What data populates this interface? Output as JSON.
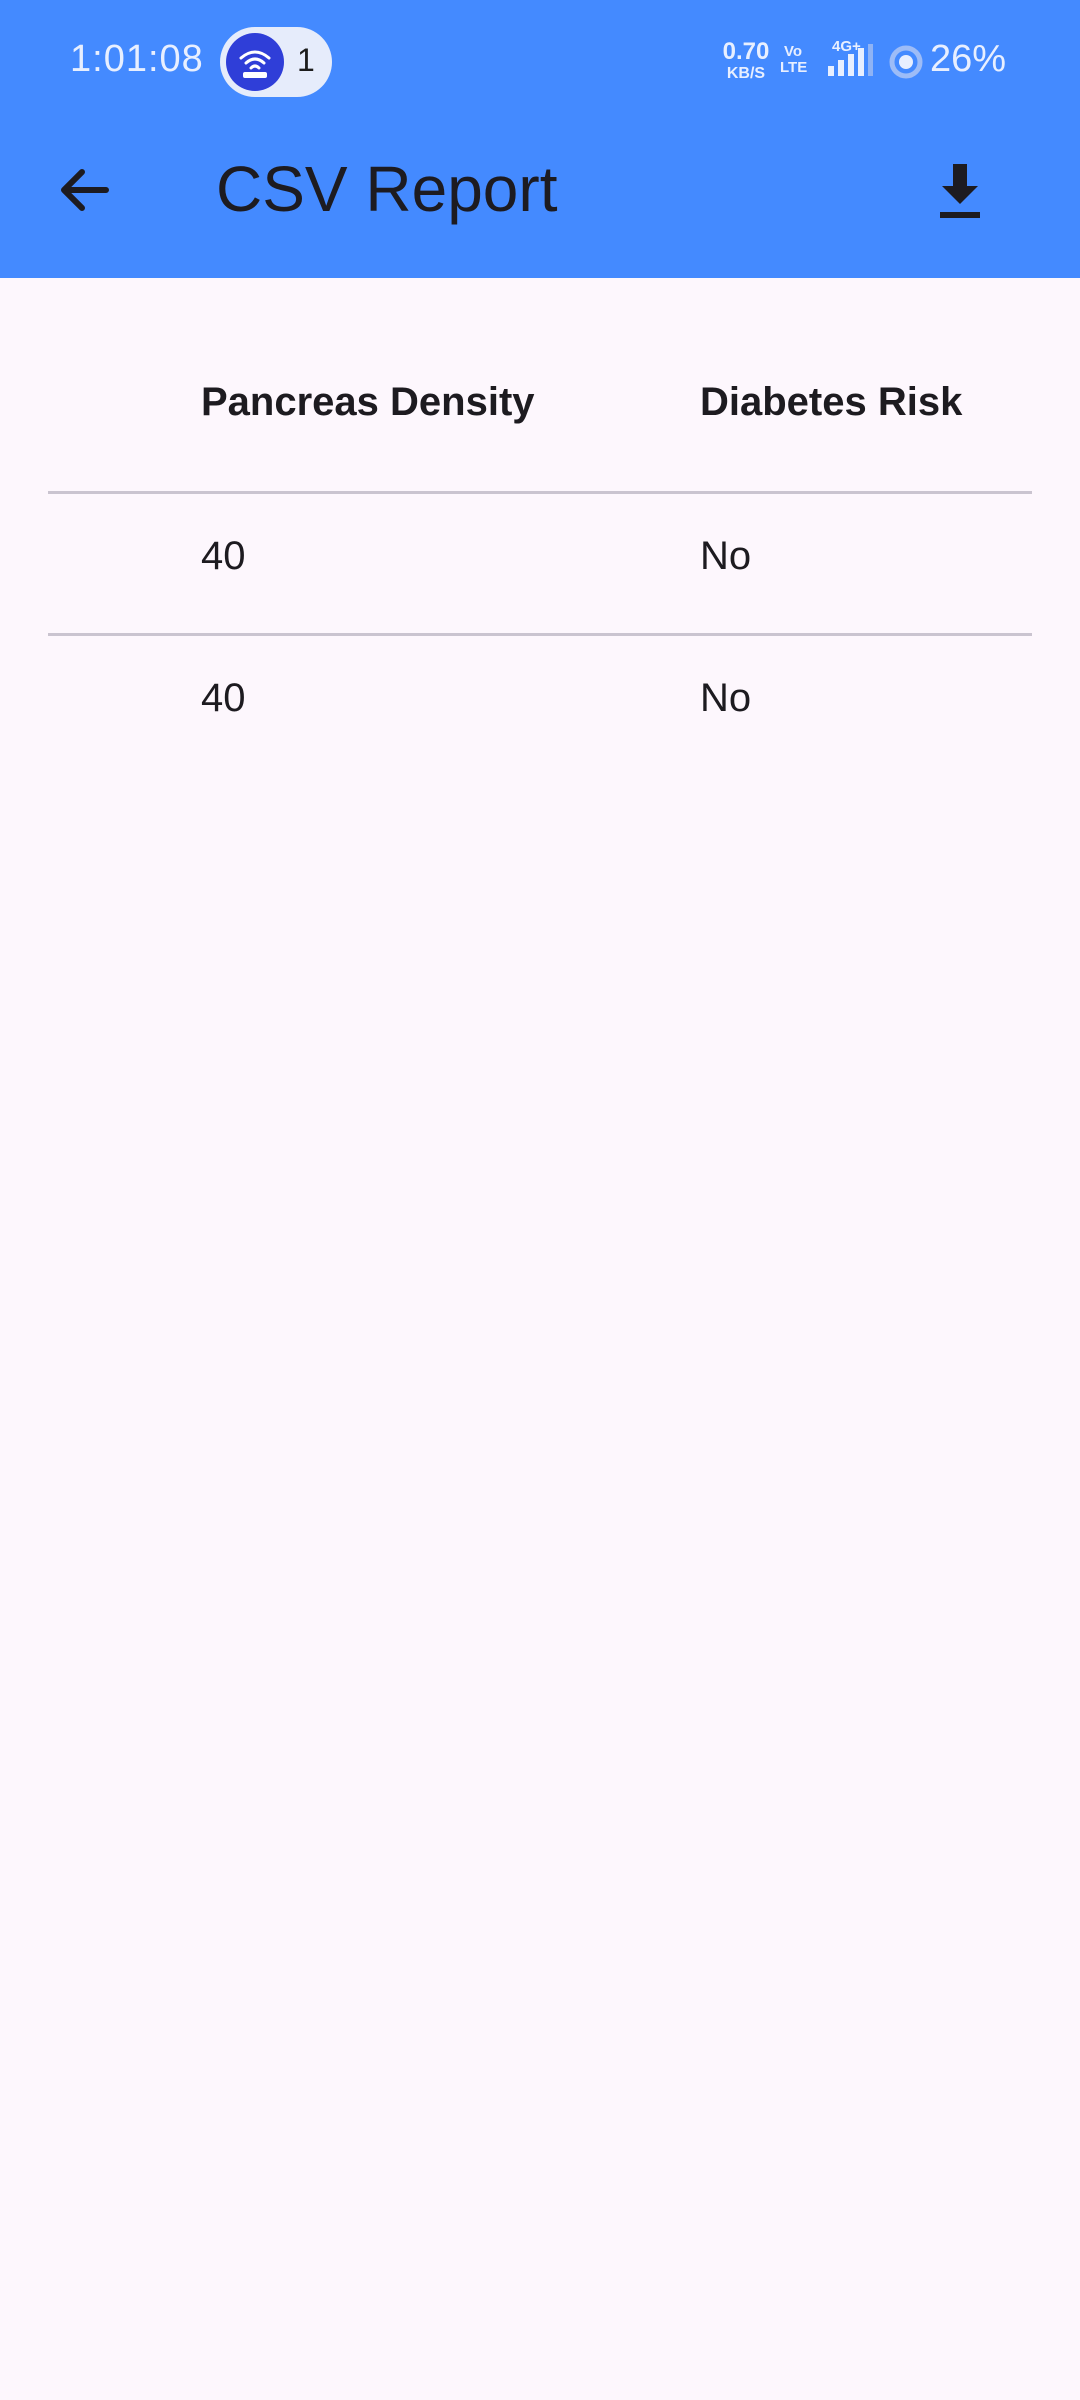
{
  "status_bar": {
    "time": "1:01:08",
    "hotspot_count": "1",
    "net_speed_value": "0.70",
    "net_speed_unit": "KB/S",
    "volte_top": "Vo",
    "volte_bottom": "LTE",
    "network_type": "4G+",
    "battery": "26%"
  },
  "appbar": {
    "title": "CSV Report",
    "background_color": "#448aff",
    "back_icon": "arrow-back-icon",
    "download_icon": "download-icon"
  },
  "table": {
    "headers": [
      "Pancreas Density",
      "Diabetes Risk"
    ],
    "rows": [
      [
        "40",
        "No"
      ],
      [
        "40",
        "No"
      ]
    ]
  }
}
